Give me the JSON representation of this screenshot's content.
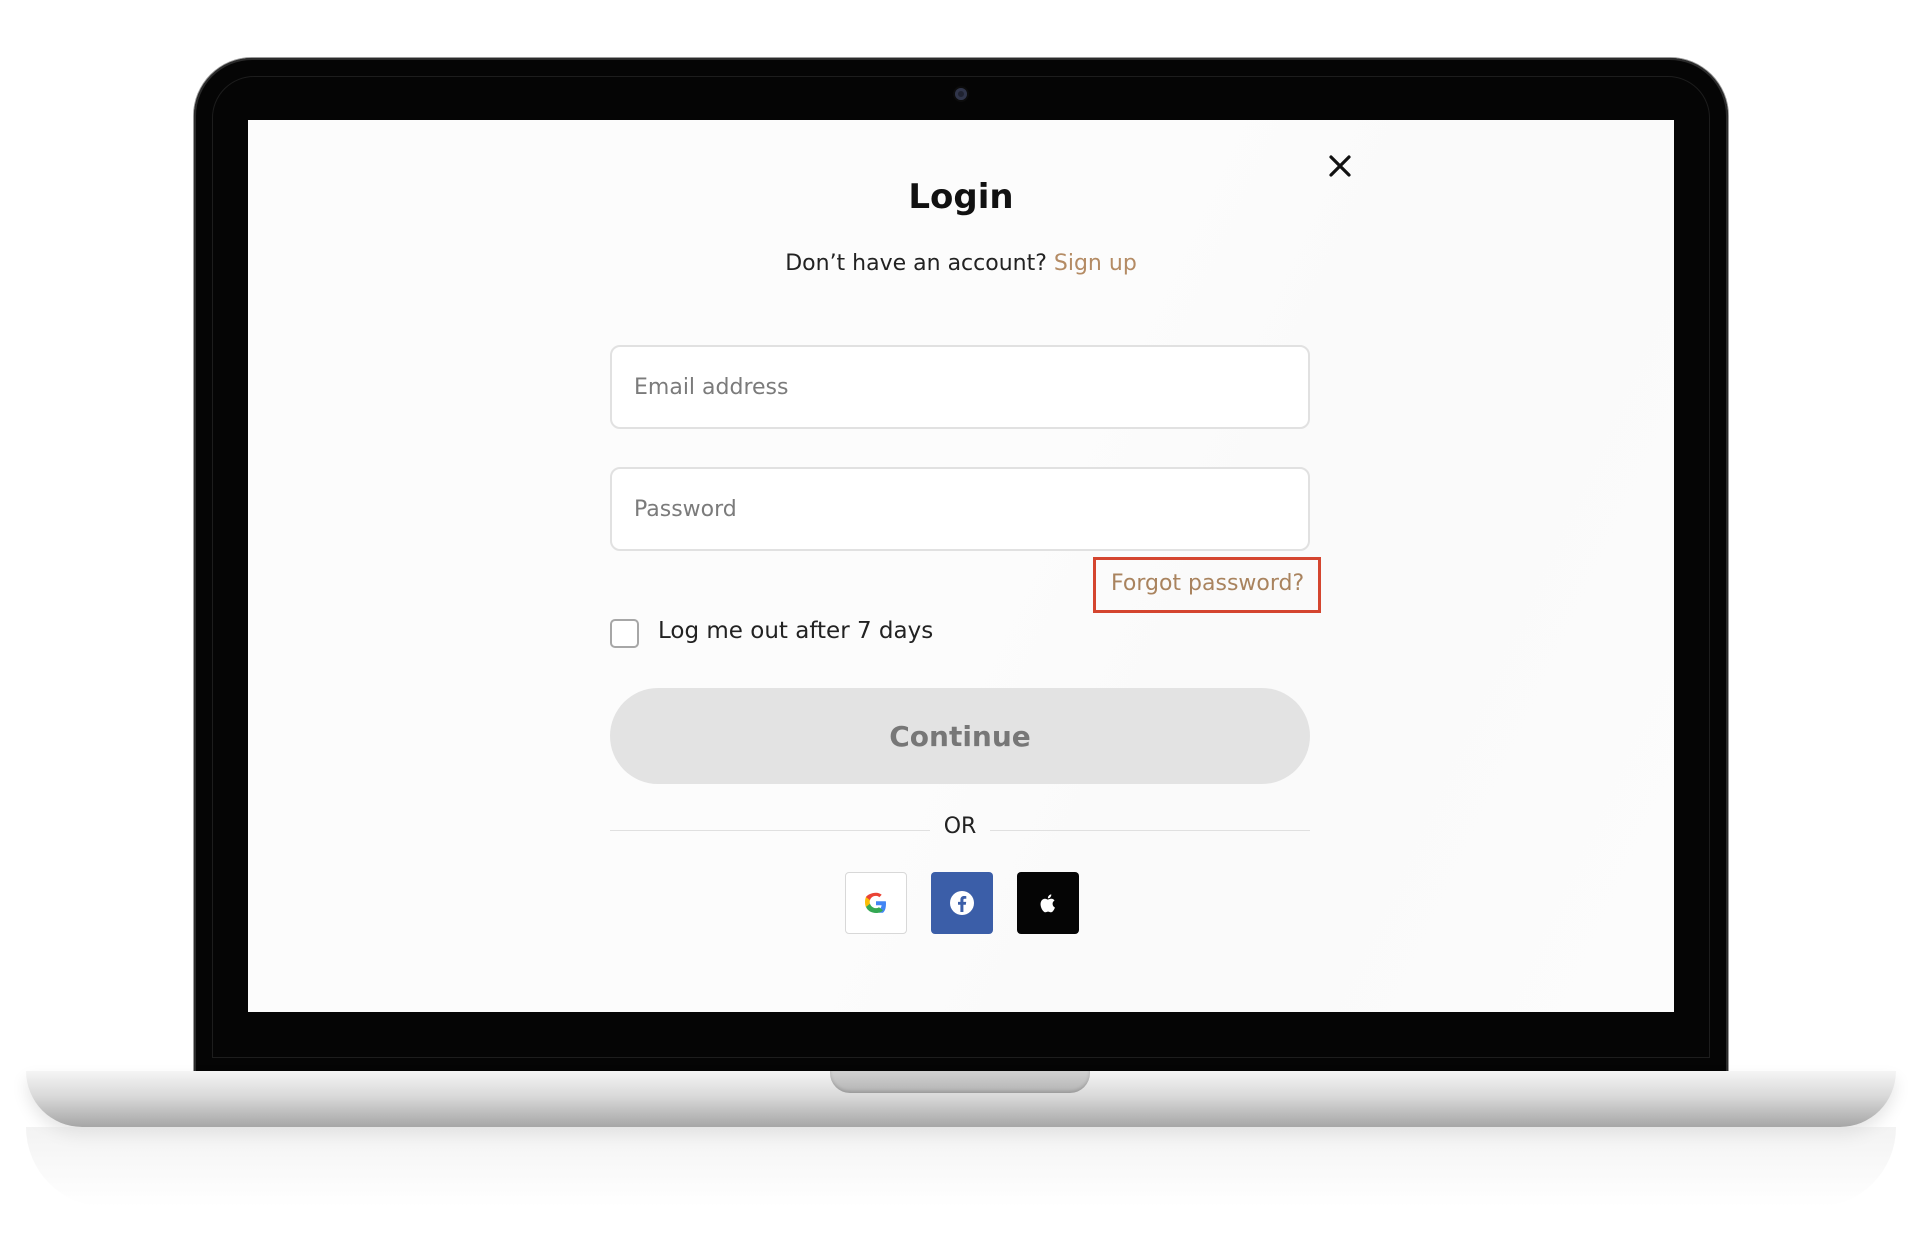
{
  "login": {
    "title": "Login",
    "subtitle_prefix": "Don’t have an account?",
    "signup_link": "Sign up",
    "email_placeholder": "Email address",
    "password_placeholder": "Password",
    "forgot_password": "Forgot password?",
    "remember_label": "Log me out after 7 days",
    "continue_label": "Continue",
    "or_text": "OR"
  },
  "icons": {
    "close": "close-icon",
    "google": "google-icon",
    "facebook": "facebook-icon",
    "apple": "apple-icon"
  },
  "colors": {
    "accent": "#b48b64",
    "highlight": "#d4452f",
    "facebook": "#3b5ea8",
    "apple": "#050505",
    "button_disabled": "#e3e3e3"
  }
}
